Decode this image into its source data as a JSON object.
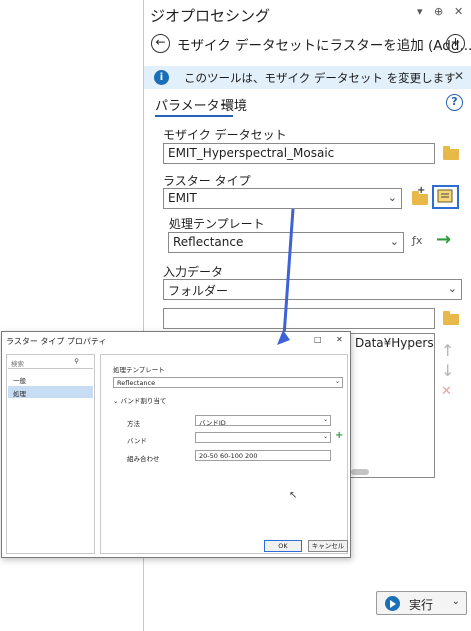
{
  "pane": {
    "title": "ジオプロセシング",
    "controls": [
      "▾",
      "⊕",
      "✕"
    ],
    "tool_title": "モザイク データセットにラスターを追加 (Add...",
    "back_icon": "back-circle-icon",
    "add_icon": "add-circle-icon",
    "info_banner": {
      "icon": "i",
      "text": "このツールは、モザイク データセット を変更します",
      "close": "✕"
    },
    "tabs": [
      "パラメーター",
      "環境"
    ],
    "help": "?",
    "mosaic_dataset": {
      "label": "モザイク データセット",
      "value": "EMIT_Hyperspectral_Mosaic"
    },
    "raster_type": {
      "label": "ラスター タイプ",
      "value": "EMIT"
    },
    "processing_template": {
      "label": "処理テンプレート",
      "value": "Reflectance"
    },
    "input_data": {
      "label": "入力データ",
      "value": "フォルダー",
      "path_partial": "Data¥Hypers"
    },
    "run_label": "実行"
  },
  "dialog": {
    "title": "ラスター タイプ プロパティ",
    "controls": [
      "□",
      "✕"
    ],
    "search_placeholder": "検索",
    "left_items": [
      "一般",
      "処理"
    ],
    "selected_item": "処理",
    "processing_template_label": "処理テンプレート",
    "processing_template_value": "Reflectance",
    "band_section": "バンド割り当て",
    "method_label": "方法",
    "method_value": "バンドID",
    "band_label": "バンド",
    "band_value": "",
    "combination_label": "組み合わせ",
    "combination_value": "20-50 60-100 200",
    "ok": "OK",
    "cancel": "キャンセル"
  },
  "colors": {
    "accent": "#2462b3",
    "arrow": "#3f62d8",
    "banner_bg": "#e1f0fb",
    "selected_item_bg": "#c7ddf3",
    "run_green": "#2e9c3f"
  }
}
